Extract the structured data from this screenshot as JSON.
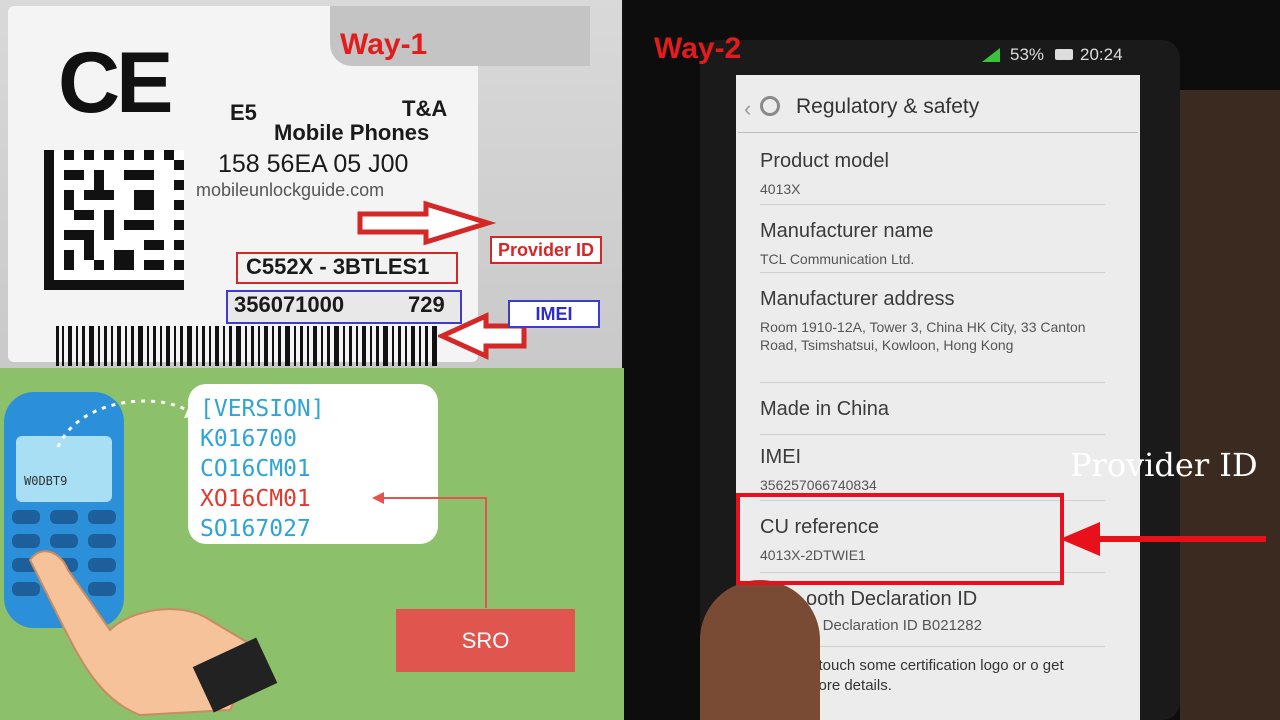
{
  "left": {
    "way_title": "Way-1",
    "label": {
      "model": "E5",
      "maker": "T&A",
      "product": "Mobile Phones",
      "code_line": "158 56EA 05 J00",
      "website": "mobileunlockguide.com",
      "provider_code": "C552X - 3BTLES1",
      "imei_start": "356071000",
      "imei_end": "729"
    },
    "callouts": {
      "provider_id": "Provider ID",
      "imei": "IMEI"
    },
    "phone_screen_text": "W0DBT9",
    "version_lines": [
      "[VERSION]",
      "K016700",
      "CO16CM01",
      "XO16CM01",
      "SO167027"
    ],
    "sro_label": "SRO"
  },
  "right": {
    "way_title": "Way-2",
    "status": {
      "battery": "53%",
      "time": "20:24"
    },
    "header_title": "Regulatory & safety",
    "items": [
      {
        "name": "Product model",
        "value": "4013X"
      },
      {
        "name": "Manufacturer name",
        "value": "TCL Communication Ltd."
      },
      {
        "name": "Manufacturer address",
        "value": "Room 1910-12A, Tower 3, China HK City, 33 Canton Road, Tsimshatsui, Kowloon, Hong Kong"
      },
      {
        "name": "Made in China",
        "value": ""
      },
      {
        "name": "IMEI",
        "value": "356257066740834"
      },
      {
        "name": "CU reference",
        "value": "4013X-2DTWIE1"
      },
      {
        "name": "ooth Declaration ID",
        "value": "th Declaration ID B021282"
      },
      {
        "name": "",
        "value": "n touch some certification logo or o get more details."
      }
    ],
    "provider_callout": "Provider ID"
  },
  "colors": {
    "accent_red": "#e21b1b",
    "green_bg": "#8cc06a",
    "sro_red": "#e0564f",
    "code_blue": "#2fa4d6"
  }
}
